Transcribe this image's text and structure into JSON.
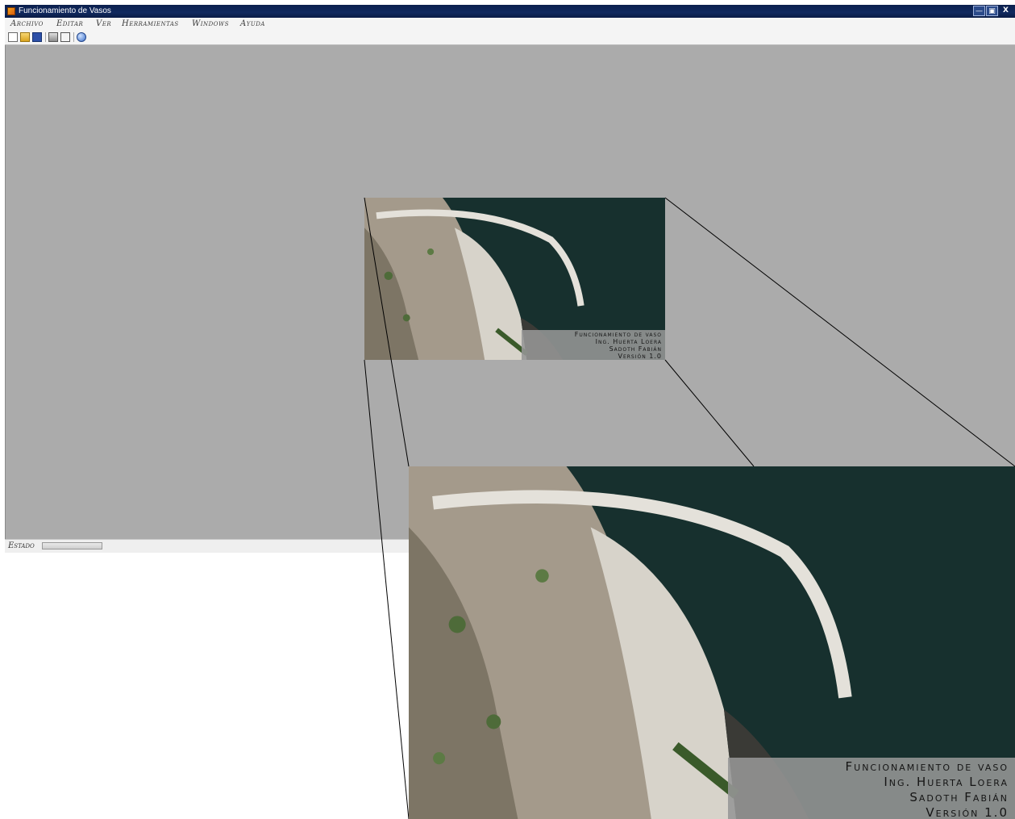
{
  "window": {
    "title": "Funcionamiento de Vasos",
    "controls": {
      "minimize": "—",
      "maximize": "▣",
      "close": "X"
    }
  },
  "menu": [
    {
      "label": "Archivo"
    },
    {
      "label": "Editar"
    },
    {
      "label": "Ver"
    },
    {
      "label": "Herramientas"
    },
    {
      "label": "Windows"
    },
    {
      "label": "Ayuda"
    }
  ],
  "toolbar": {
    "buttons": [
      "new-icon",
      "open-folder-icon",
      "save-icon",
      "print-icon",
      "print-preview-icon",
      "help-globe-icon"
    ]
  },
  "status": {
    "label": "Estado",
    "progress": 0
  },
  "splash": {
    "lines": [
      "Funcionamiento de vaso",
      "Ing. Huerta Loera",
      "Sadoth Fabián",
      "Versión 1.0"
    ]
  },
  "colors": {
    "title_bar": "#10295f",
    "mdi_background": "#ababab",
    "water": "#17302e"
  }
}
